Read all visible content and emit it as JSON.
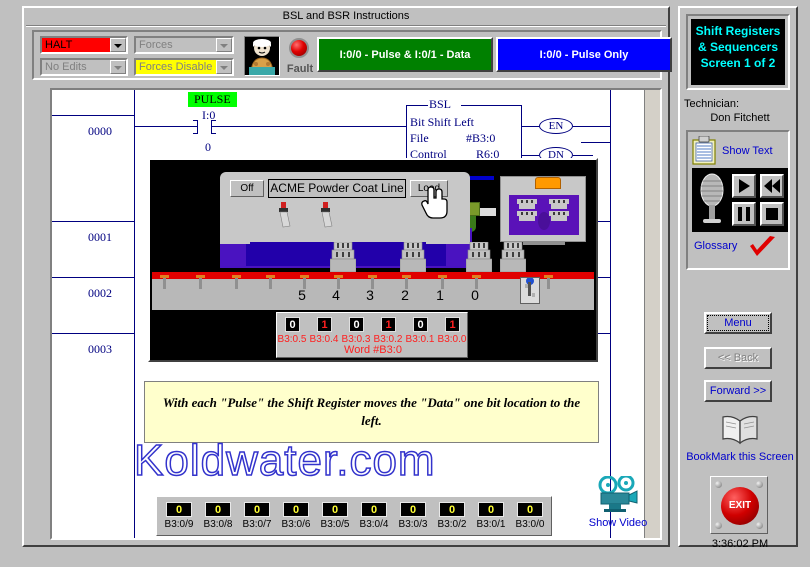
{
  "window": {
    "title": "BSL and BSR Instructions"
  },
  "toolbar": {
    "mode_select": {
      "value": "HALT",
      "color": "#ff0000"
    },
    "forces_select": {
      "value": "Forces"
    },
    "edits_select": {
      "value": "No Edits"
    },
    "forces_disable_select": {
      "value": "Forces Disable",
      "color": "#ffff00"
    },
    "fault_label": "Fault",
    "buttons": [
      {
        "name": "pulse-and-data",
        "label": "I:0/0 - Pulse  & I:0/1 - Data",
        "color": "#008000"
      },
      {
        "name": "pulse-only",
        "label": "I:0/0 - Pulse Only",
        "color": "#0000ff"
      }
    ]
  },
  "ladder": {
    "rungs": [
      "0000",
      "0001",
      "0002",
      "0003"
    ],
    "contact_tag": "PULSE",
    "contact_address": "I:0",
    "contact_bit": "0",
    "instruction": {
      "mnemonic": "BSL",
      "description": "Bit Shift Left",
      "operands": [
        {
          "label": "File",
          "value": "#B3:0"
        },
        {
          "label": "Control",
          "value": "R6:0"
        }
      ],
      "outputs": [
        "EN",
        "DN"
      ]
    }
  },
  "animation": {
    "off_button": "Off",
    "line_label": "ACME Powder Coat Line",
    "load_button": "Load",
    "conveyor_positions": [
      "5",
      "4",
      "3",
      "2",
      "1",
      "0"
    ]
  },
  "bits_panel": {
    "word_label": "Word  #B3:0",
    "bits": [
      {
        "label": "B3:0.5",
        "value": "0",
        "color": "#ffffff"
      },
      {
        "label": "B3:0.4",
        "value": "1",
        "color": "#ff2020"
      },
      {
        "label": "B3:0.3",
        "value": "0",
        "color": "#ffffff"
      },
      {
        "label": "B3:0.2",
        "value": "1",
        "color": "#ff2020"
      },
      {
        "label": "B3:0.1",
        "value": "0",
        "color": "#ffffff"
      },
      {
        "label": "B3:0.0",
        "value": "1",
        "color": "#ff2020"
      }
    ]
  },
  "note": {
    "text": "With each \"Pulse\" the Shift Register moves the \"Data\" one bit location to the left."
  },
  "watermark": {
    "text": "Koldwater.com"
  },
  "bottom_bits": {
    "bits": [
      {
        "label": "B3:0/9",
        "value": "0"
      },
      {
        "label": "B3:0/8",
        "value": "0"
      },
      {
        "label": "B3:0/7",
        "value": "0"
      },
      {
        "label": "B3:0/6",
        "value": "0"
      },
      {
        "label": "B3:0/5",
        "value": "0"
      },
      {
        "label": "B3:0/4",
        "value": "0"
      },
      {
        "label": "B3:0/3",
        "value": "0"
      },
      {
        "label": "B3:0/2",
        "value": "0"
      },
      {
        "label": "B3:0/1",
        "value": "0"
      },
      {
        "label": "B3:0/0",
        "value": "0"
      }
    ]
  },
  "show_video": {
    "label": "Show Video"
  },
  "sidebar": {
    "screen_title": "Shift Registers & Sequencers Screen 1 of 2",
    "technician_label": "Technician:",
    "technician_name": "Don Fitchett",
    "show_text": "Show Text",
    "glossary": "Glossary",
    "nav": {
      "menu": "Menu",
      "back": "<< Back",
      "forward": "Forward >>"
    },
    "bookmark": "BookMark this Screen",
    "exit": "EXIT",
    "clock": "3:36:02 PM"
  }
}
